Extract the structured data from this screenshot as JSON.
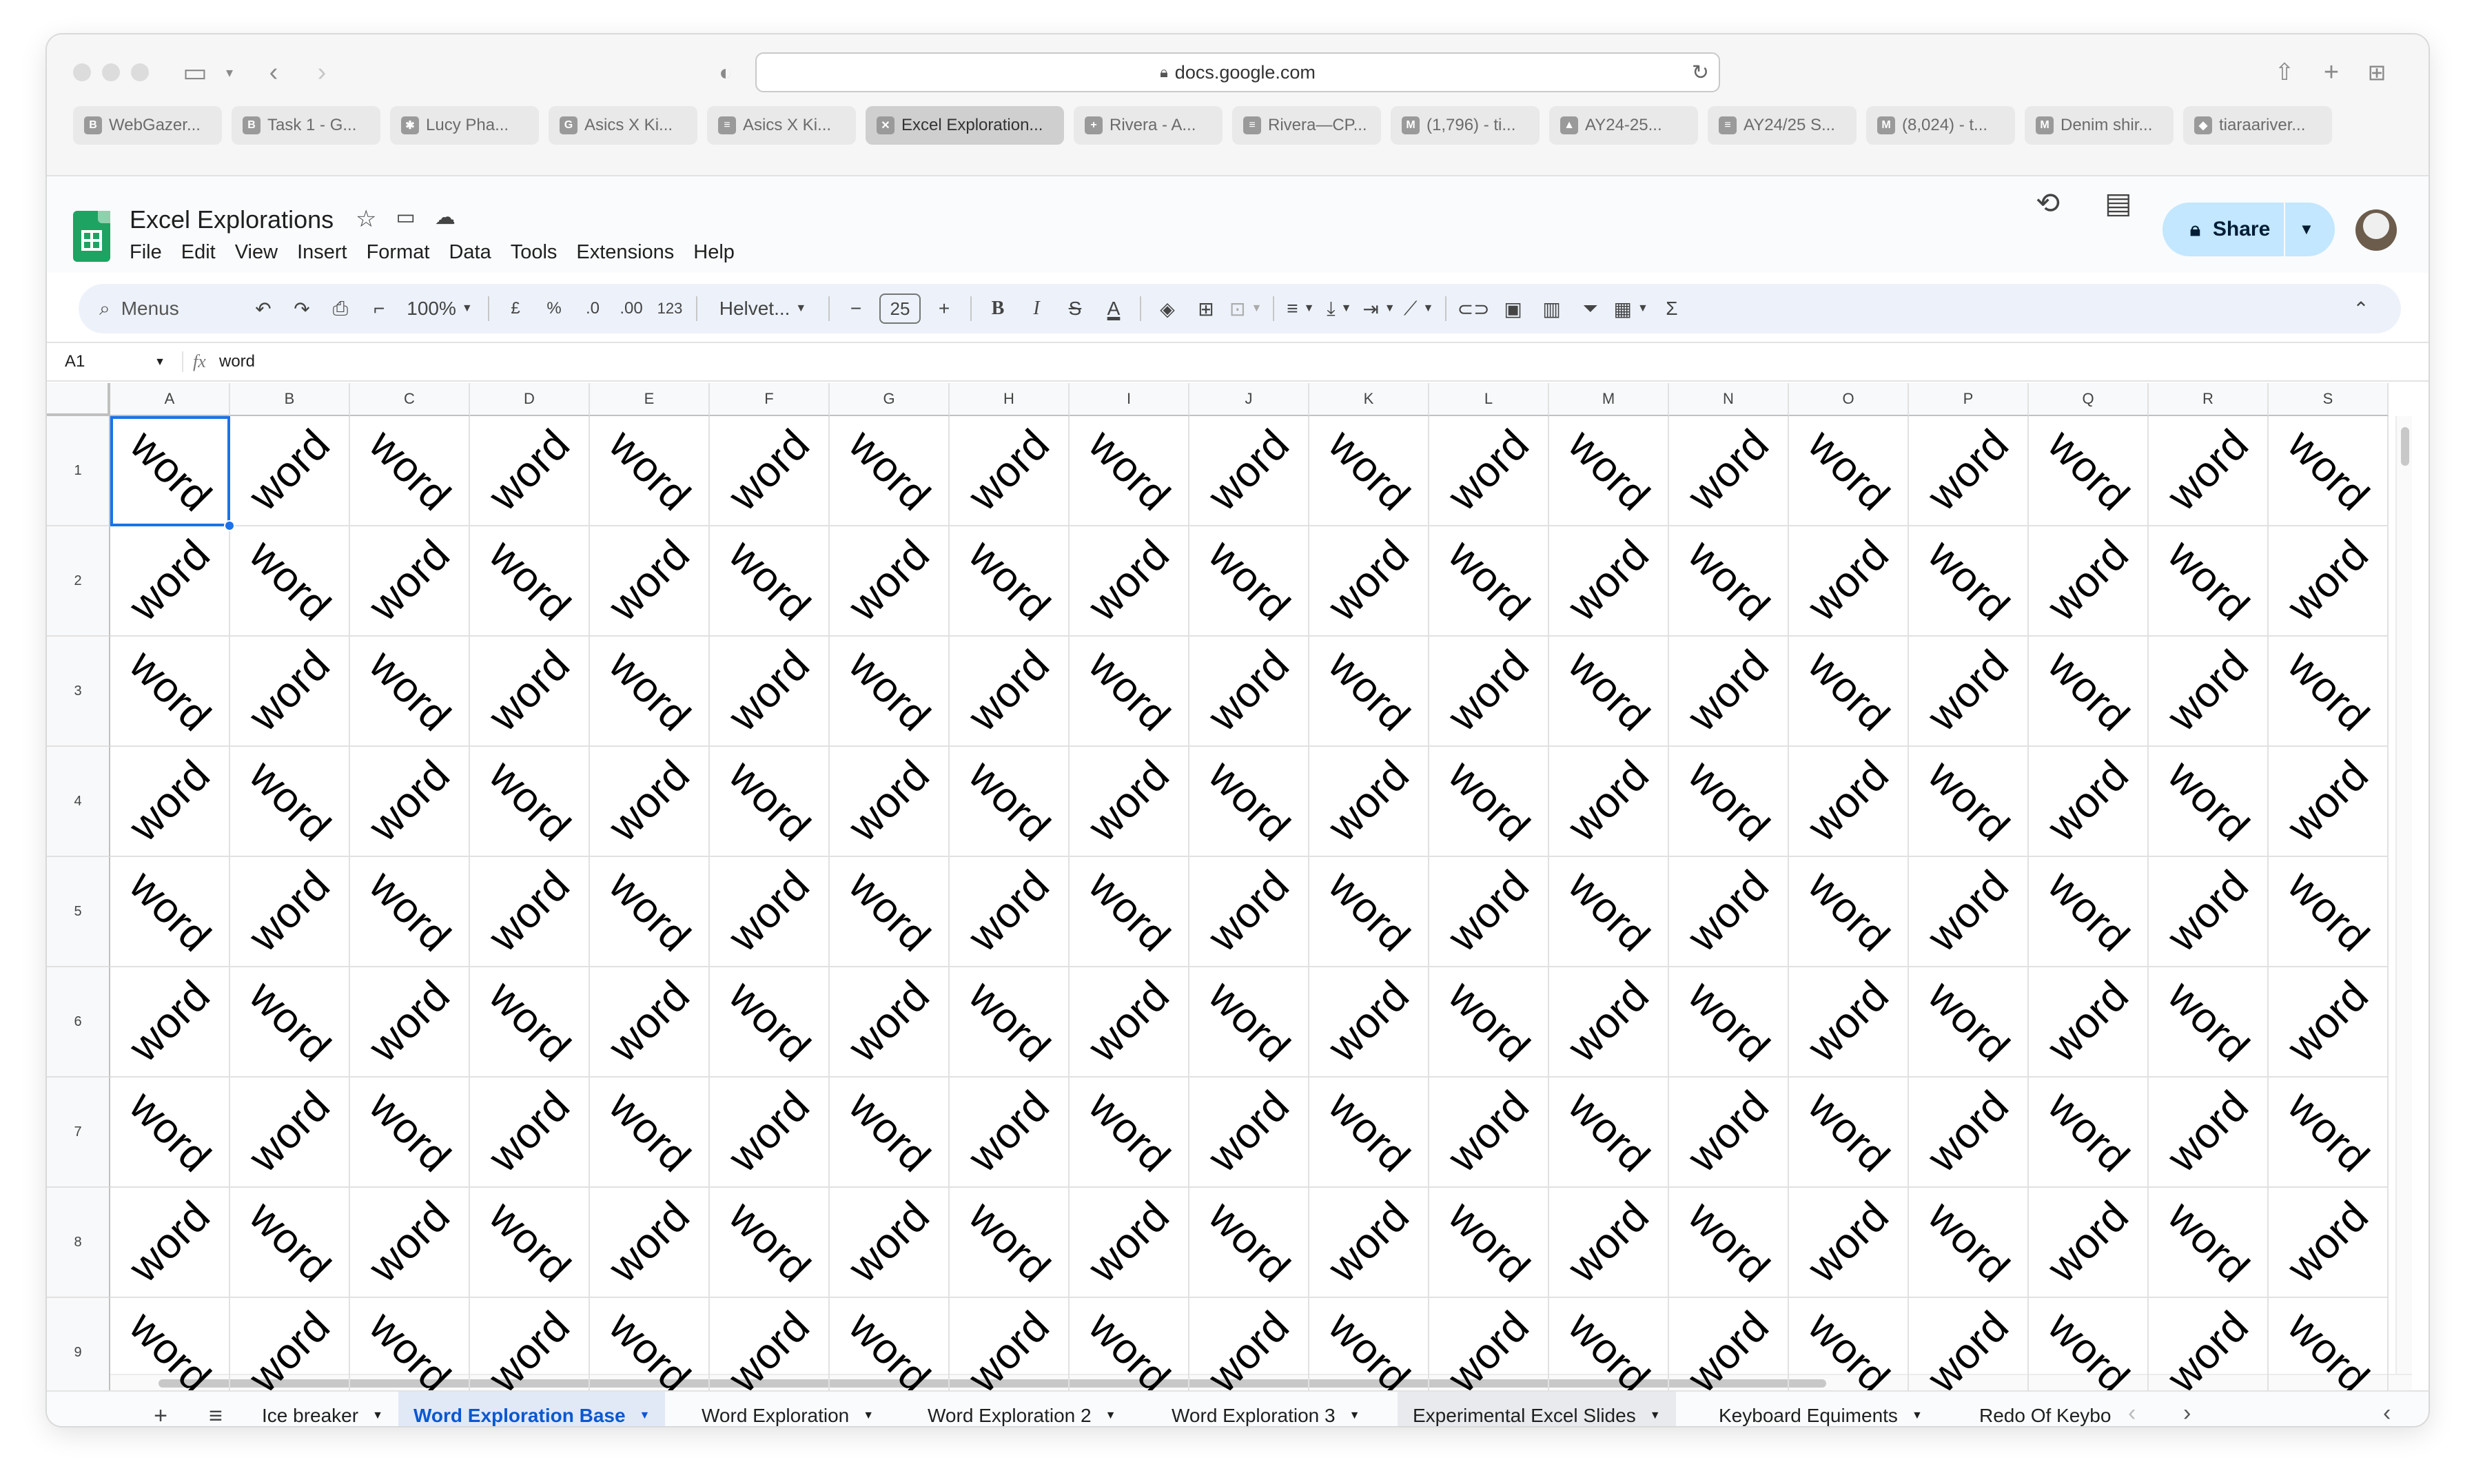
{
  "browser": {
    "url": "docs.google.com",
    "tabs": [
      {
        "label": "WebGazer...",
        "icon": "B"
      },
      {
        "label": "Task 1 - G...",
        "icon": "B"
      },
      {
        "label": "Lucy Pha...",
        "icon": "✱"
      },
      {
        "label": "Asics X Ki...",
        "icon": "G"
      },
      {
        "label": "Asics X Ki...",
        "icon": "≡"
      },
      {
        "label": "Excel Exploration...",
        "icon": "✕",
        "active": true
      },
      {
        "label": "Rivera - A...",
        "icon": "+"
      },
      {
        "label": "Rivera—CP...",
        "icon": "≡"
      },
      {
        "label": "(1,796) - ti...",
        "icon": "M"
      },
      {
        "label": "AY24-25...",
        "icon": "▲"
      },
      {
        "label": "AY24/25 S...",
        "icon": "≡"
      },
      {
        "label": "(8,024) - t...",
        "icon": "M"
      },
      {
        "label": "Denim shir...",
        "icon": "M"
      },
      {
        "label": "tiaraariver...",
        "icon": "◆"
      }
    ]
  },
  "doc": {
    "title": "Excel Explorations",
    "menu": [
      "File",
      "Edit",
      "View",
      "Insert",
      "Format",
      "Data",
      "Tools",
      "Extensions",
      "Help"
    ],
    "share_label": "Share"
  },
  "toolbar": {
    "menus_label": "Menus",
    "zoom": "100%",
    "currency": "£",
    "percent": "%",
    "dec_decrease": ".0",
    "dec_increase": ".00",
    "number_format": "123",
    "font": "Helvet...",
    "font_size": "25",
    "bold": "B",
    "italic": "I",
    "strikethrough": "S",
    "text_color": "A",
    "sum": "Σ"
  },
  "formula_bar": {
    "cell_ref": "A1",
    "fx": "fx",
    "value": "word"
  },
  "grid": {
    "columns": [
      "A",
      "B",
      "C",
      "D",
      "E",
      "F",
      "G",
      "H",
      "I",
      "J",
      "K",
      "L",
      "M",
      "N",
      "O",
      "P",
      "Q",
      "R",
      "S"
    ],
    "rows": [
      "1",
      "2",
      "3",
      "4",
      "5",
      "6",
      "7",
      "8",
      "9"
    ],
    "cell_text": "word",
    "selected_cell": "A1"
  },
  "sheets": {
    "tabs": [
      {
        "label": "Ice breaker"
      },
      {
        "label": "Word Exploration Base",
        "active": true
      },
      {
        "label": "Word Exploration"
      },
      {
        "label": "Word Exploration 2"
      },
      {
        "label": "Word Exploration 3"
      },
      {
        "label": "Experimental Excel Slides",
        "highlight": true
      },
      {
        "label": "Keyboard Equiments"
      },
      {
        "label": "Redo Of Keybo"
      }
    ]
  },
  "colors": {
    "accent": "#1a73e8",
    "share_bg": "#c2e7ff",
    "sheets_green": "#1ea362",
    "toolbar_bg": "#edf2fa"
  }
}
